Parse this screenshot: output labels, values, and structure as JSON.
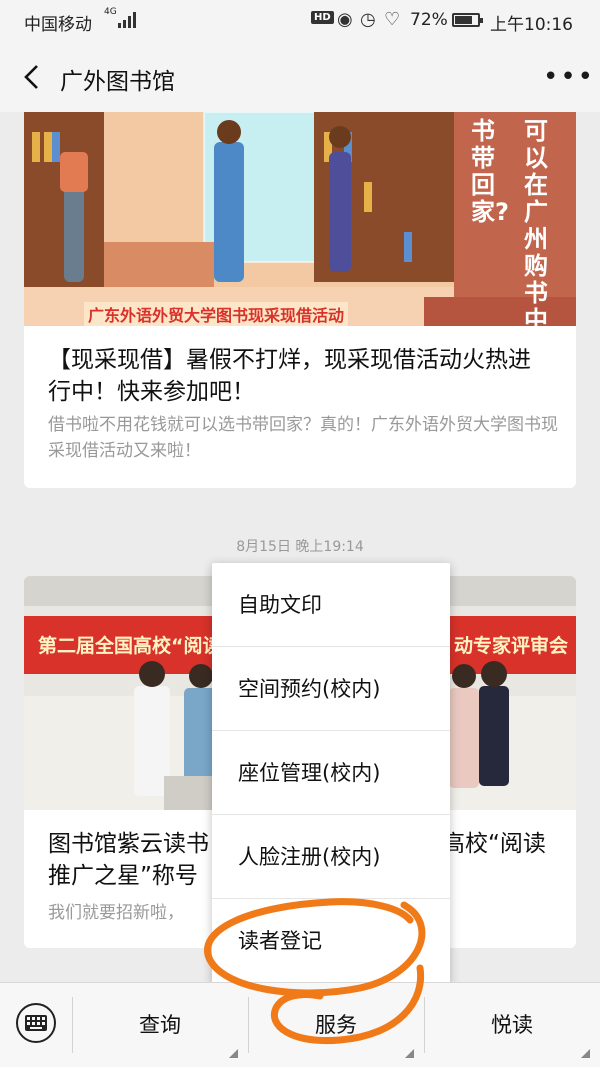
{
  "status_bar": {
    "carrier": "中国移动",
    "network": "4G",
    "hd_badge": "HD",
    "battery_percent": "72%",
    "time": "上午10:16"
  },
  "nav": {
    "title": "广外图书馆"
  },
  "articles": [
    {
      "image_text": {
        "banner": "广东外语外贸大学图书现采现借活动",
        "side_text": "可以在广州购书中",
        "side_text_alt": "书带回家?"
      },
      "title": "【现采现借】暑假不打烊，现采现借活动火热进行中！快来参加吧！",
      "desc": "借书啦不用花钱就可以选书带回家？真的！广东外语外贸大学图书现采现借活动又来啦！"
    },
    {
      "image_text": {
        "banner_left": "第二届全国高校“阅读",
        "banner_right": "动专家评审会"
      },
      "title_left": "图书馆紫云读书",
      "title_right": "高校“阅读",
      "title_line2": "推广之星”称号",
      "desc": "我们就要招新啦，"
    }
  ],
  "timestamp": "8月15日 晚上19:14",
  "popup_menu": {
    "items": [
      "自助文印",
      "空间预约(校内)",
      "座位管理(校内)",
      "人脸注册(校内)",
      "读者登记"
    ]
  },
  "bottom_menu": {
    "tabs": [
      "查询",
      "服务",
      "悦读"
    ]
  },
  "colors": {
    "annotation": "#f07a18",
    "banner_red": "#d8322a"
  }
}
